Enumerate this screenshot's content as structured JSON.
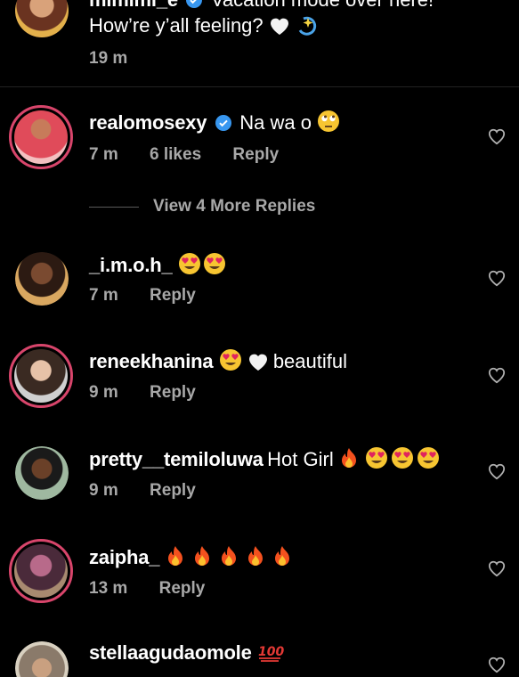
{
  "top_comment": {
    "username": "mimimi_e",
    "line1": "Vacation mode over here!",
    "line2": "How’re y’all feeling?",
    "time": "19 m"
  },
  "comments": [
    {
      "username": "realomosexy",
      "verified": true,
      "text": "Na wa o",
      "time": "7 m",
      "likes": "6 likes",
      "reply": "Reply"
    },
    {
      "username": "_i.m.o.h_",
      "text": "",
      "time": "7 m",
      "reply": "Reply"
    },
    {
      "username": "reneekhanina",
      "text": "beautiful",
      "time": "9 m",
      "reply": "Reply"
    },
    {
      "username": "pretty__temiloluwa",
      "text": "Hot Girl",
      "time": "9 m",
      "reply": "Reply"
    },
    {
      "username": "zaipha_",
      "text": "",
      "time": "13 m",
      "reply": "Reply"
    },
    {
      "username": "stellaagudaomole",
      "text": "",
      "time": "",
      "reply": ""
    }
  ],
  "view_more": "View 4 More Replies",
  "colors": {
    "background": "#000000",
    "meta": "#a8a8a8",
    "verified": "#3897f0",
    "story_ring": "#d8456b"
  },
  "icons": [
    "heart-outline-icon",
    "verified-badge-icon",
    "white-heart-emoji",
    "sparkle-emoji",
    "eye-roll-emoji",
    "heart-eyes-emoji",
    "fire-emoji",
    "hundred-emoji"
  ]
}
